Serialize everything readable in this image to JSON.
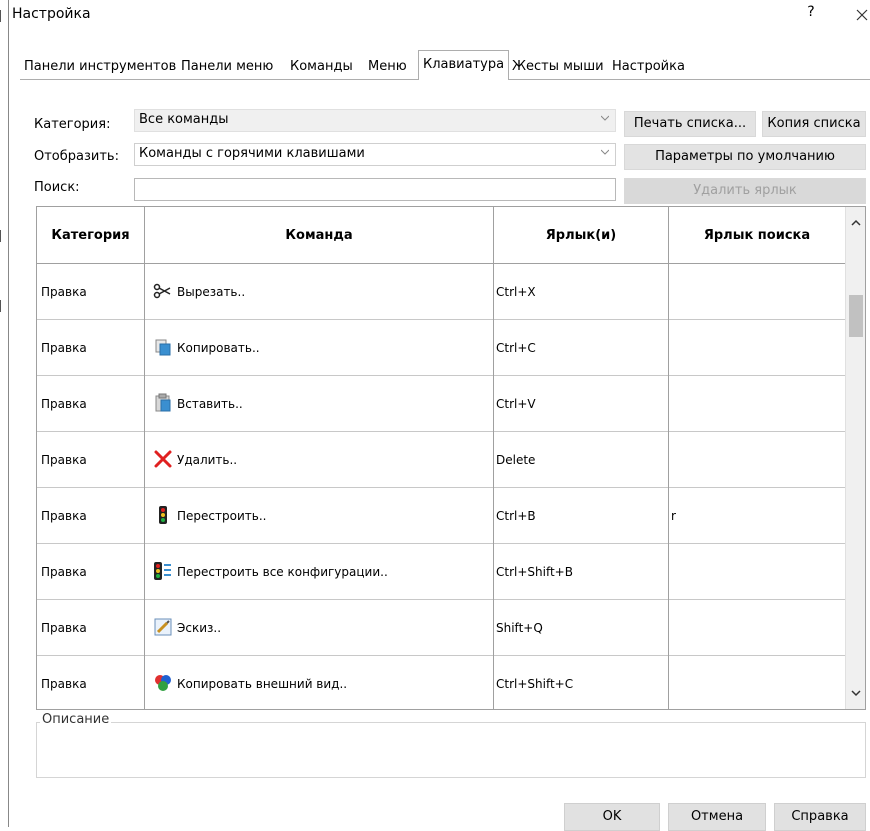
{
  "window": {
    "title": "Настройка",
    "help_label": "?",
    "close_label": "✕"
  },
  "tabs": [
    {
      "label": "Панели инструментов",
      "active": false
    },
    {
      "label": "Панели меню",
      "active": false
    },
    {
      "label": "Команды",
      "active": false
    },
    {
      "label": "Меню",
      "active": false
    },
    {
      "label": "Клавиатура",
      "active": true
    },
    {
      "label": "Жесты мыши",
      "active": false
    },
    {
      "label": "Настройка",
      "active": false
    }
  ],
  "filters": {
    "category_label": "Категория:",
    "category_value": "Все команды",
    "display_label": "Отобразить:",
    "display_value": "Команды с горячими клавишами",
    "search_label": "Поиск:",
    "search_value": ""
  },
  "actions": {
    "print_list": "Печать списка...",
    "copy_list": "Копия списка",
    "defaults": "Параметры по умолчанию",
    "remove_shortcut": "Удалить ярлык"
  },
  "table": {
    "columns": [
      "Категория",
      "Команда",
      "Ярлык(и)",
      "Ярлык поиска"
    ],
    "rows": [
      {
        "category": "Правка",
        "icon": "scissors-icon",
        "command": "Вырезать..",
        "shortcut": "Ctrl+X",
        "search_shortcut": ""
      },
      {
        "category": "Правка",
        "icon": "copy-icon",
        "command": "Копировать..",
        "shortcut": "Ctrl+C",
        "search_shortcut": ""
      },
      {
        "category": "Правка",
        "icon": "paste-icon",
        "command": "Вставить..",
        "shortcut": "Ctrl+V",
        "search_shortcut": ""
      },
      {
        "category": "Правка",
        "icon": "delete-icon",
        "command": "Удалить..",
        "shortcut": "Delete",
        "search_shortcut": ""
      },
      {
        "category": "Правка",
        "icon": "traffic-light-icon",
        "command": "Перестроить..",
        "shortcut": "Ctrl+B",
        "search_shortcut": "r"
      },
      {
        "category": "Правка",
        "icon": "rebuild-all-icon",
        "command": "Перестроить все конфигурации..",
        "shortcut": "Ctrl+Shift+B",
        "search_shortcut": ""
      },
      {
        "category": "Правка",
        "icon": "sketch-icon",
        "command": "Эскиз..",
        "shortcut": "Shift+Q",
        "search_shortcut": ""
      },
      {
        "category": "Правка",
        "icon": "appearance-icon",
        "command": "Копировать внешний вид..",
        "shortcut": "Ctrl+Shift+C",
        "search_shortcut": ""
      }
    ]
  },
  "description": {
    "label": "Описание",
    "text": ""
  },
  "footer": {
    "ok": "OK",
    "cancel": "Отмена",
    "help": "Справка"
  }
}
